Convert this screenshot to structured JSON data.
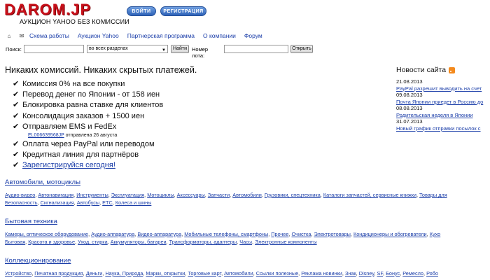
{
  "header": {
    "logo": "DAROM.JP",
    "tagline": "АУКЦИОН YAHOO БЕЗ КОМИССИИ",
    "login_label": "ВОЙТИ",
    "register_label": "РЕГИСТРАЦИЯ"
  },
  "nav": {
    "items": [
      "Схема работы",
      "Аукцион Yahoo",
      "Партнерская программа",
      "О компании",
      "Форум"
    ]
  },
  "search": {
    "label": "Поиск:",
    "scope": "во всех разделах",
    "find_label": "Найти",
    "lot_label": "Номер лота:",
    "open_label": "Открыть"
  },
  "main": {
    "headline": "Никаких комиссий. Никаких скрытых платежей.",
    "features": [
      "Комиссия 0% на все покупки",
      "Перевод денег по Японии - от 158 иен",
      "Блокировка равна ставке для клиентов",
      "Консолидация заказов + 1500 иен",
      "Отправляем EMS и FedEx"
    ],
    "tracking_id": "EL006639568JP",
    "tracking_suffix": "отправлена 26 августа",
    "features2": [
      "Оплата через PayPal или переводом",
      "Кредитная линия для партнёров"
    ],
    "register_link": "Зарегистрируйся сегодня!"
  },
  "categories": [
    {
      "title": "Автомобили, мотоциклы",
      "rows": [
        [
          "Аудио-видео",
          "Автонавигация",
          "Инструменты",
          "Эксплуатация",
          "Мотоциклы",
          "Аксессуары",
          "Запчасти",
          "Автомобили",
          "Грузовики, спецтехника",
          "Каталоги запчастей, сервисные книжки",
          "Товары для"
        ],
        [
          "Безопасность",
          "Сигнализация",
          "Автобусы",
          "ETC",
          "Колеса и шины"
        ]
      ]
    },
    {
      "title": "Бытовая техника",
      "rows": [
        [
          "Камеры, оптическое оборудование",
          "Аудио-аппаратура",
          "Видео-аппаратура",
          "Мобильные телефоны, смартфоны",
          "Прочее",
          "Очистка",
          "Электротовары",
          "Кондиционеры и обогреватели",
          "Кухо"
        ],
        [
          "Бытовая",
          "Красота и здоровье",
          "Уход, стирка",
          "Аккумуляторы, батареи",
          "Трансформаторы, адаптеры",
          "Часы",
          "Электронные компоненты"
        ]
      ]
    },
    {
      "title": "Коллекционирование",
      "rows": [
        [
          "Устройство",
          "Печатная продукция",
          "Деньги",
          "Наука, Природа",
          "Марки, открытки",
          "Торговые карт",
          "Автомобили",
          "Ссылки полезные",
          "Реклама новинки",
          "Знак",
          "Disney",
          "SF",
          "Бонус",
          "Ремесло",
          "Робо"
        ]
      ]
    }
  ],
  "news": {
    "title": "Новости сайта",
    "entries": [
      {
        "date": "21.08.2013",
        "title": "PayPal разрешит выводить на счет"
      },
      {
        "date": "09.08.2013",
        "title": "Почта Японии приедет в Россию до"
      },
      {
        "date": "08.08.2013",
        "title": "Родительская неделя в Японии"
      },
      {
        "date": "31.07.2013",
        "title": "Новый график отправки посылок с"
      }
    ]
  },
  "colors": {
    "logo": "#c8101a",
    "link": "#1a3da8",
    "button": "#2e62b8",
    "rss": "#f48a1d"
  }
}
